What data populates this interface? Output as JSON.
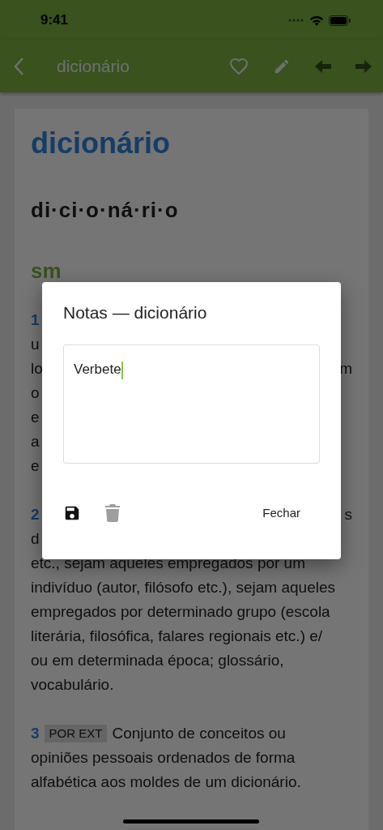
{
  "status_bar": {
    "time": "9:41"
  },
  "app_bar": {
    "title": "dicionário"
  },
  "entry": {
    "headword": "dicionário",
    "syllables": "di·ci·o·ná·ri·o",
    "part_of_speech": "sm",
    "senses": [
      {
        "number": "1",
        "lines": [
          {
            "left": "u"
          },
          {
            "left": "lo",
            "right": "m"
          },
          {
            "left": "o"
          },
          {
            "left": "e"
          },
          {
            "left": "a"
          },
          {
            "left": "e"
          }
        ]
      },
      {
        "number": "2",
        "right": "s",
        "lines": [
          {
            "left": "d"
          },
          {
            "left": "etc., sejam aqueles empregados por um"
          },
          {
            "left": "indivíduo (autor, filósofo etc.), sejam aqueles"
          },
          {
            "left": "empregados por determinado grupo (escola"
          },
          {
            "left": "literária, filosófica, falares regionais etc.) e/"
          },
          {
            "left": "ou em determinada época; glossário,"
          },
          {
            "left": "vocabulário."
          }
        ]
      },
      {
        "number": "3",
        "tags": [
          "POR EXT"
        ],
        "text": "Conjunto de conceitos ou",
        "lines": [
          {
            "left": "opiniões pessoais ordenados de forma"
          },
          {
            "left": "alfabética aos moldes de um dicionário."
          }
        ]
      }
    ]
  },
  "dialog": {
    "title": "Notas — dicionário",
    "value": "Verbete",
    "save_disabled": false,
    "delete_disabled": true,
    "close_label": "Fechar"
  }
}
